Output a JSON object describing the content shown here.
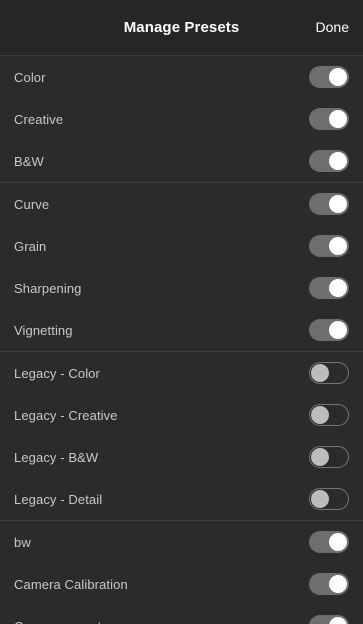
{
  "header": {
    "title": "Manage Presets",
    "done_label": "Done"
  },
  "groups": [
    {
      "items": [
        {
          "label": "Color",
          "enabled": true
        },
        {
          "label": "Creative",
          "enabled": true
        },
        {
          "label": "B&W",
          "enabled": true
        }
      ]
    },
    {
      "items": [
        {
          "label": "Curve",
          "enabled": true
        },
        {
          "label": "Grain",
          "enabled": true
        },
        {
          "label": "Sharpening",
          "enabled": true
        },
        {
          "label": "Vignetting",
          "enabled": true
        }
      ]
    },
    {
      "items": [
        {
          "label": "Legacy - Color",
          "enabled": false
        },
        {
          "label": "Legacy - Creative",
          "enabled": false
        },
        {
          "label": "Legacy - B&W",
          "enabled": false
        },
        {
          "label": "Legacy - Detail",
          "enabled": false
        }
      ]
    },
    {
      "items": [
        {
          "label": "bw",
          "enabled": true
        },
        {
          "label": "Camera Calibration",
          "enabled": true
        },
        {
          "label": "Camera presets",
          "enabled": true
        }
      ]
    }
  ],
  "colors": {
    "background": "#2b2b2b",
    "toggle_on": "#6e6e6e",
    "toggle_off_border": "#747474",
    "text": "#c8c8c8"
  }
}
